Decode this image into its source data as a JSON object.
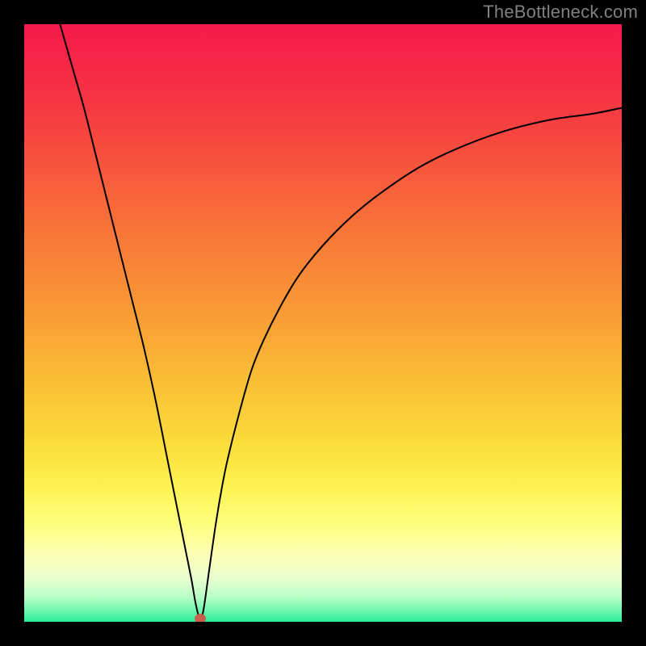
{
  "watermark": "TheBottleneck.com",
  "colors": {
    "background": "#000000",
    "gradient_stops": [
      {
        "pct": 0,
        "color": "#f51a4b"
      },
      {
        "pct": 10,
        "color": "#f62e44"
      },
      {
        "pct": 22,
        "color": "#f7503d"
      },
      {
        "pct": 35,
        "color": "#f87638"
      },
      {
        "pct": 48,
        "color": "#f99a35"
      },
      {
        "pct": 60,
        "color": "#fabf35"
      },
      {
        "pct": 72,
        "color": "#fbe23c"
      },
      {
        "pct": 78,
        "color": "#fdf455"
      },
      {
        "pct": 84,
        "color": "#feff82"
      },
      {
        "pct": 89,
        "color": "#fcffb8"
      },
      {
        "pct": 93,
        "color": "#e6ffcf"
      },
      {
        "pct": 96,
        "color": "#b4ffc6"
      },
      {
        "pct": 98,
        "color": "#72f8af"
      },
      {
        "pct": 100,
        "color": "#2aee98"
      }
    ],
    "curve_stroke": "#000000",
    "dot": "#c86050"
  },
  "chart_data": {
    "type": "line",
    "title": "",
    "xlabel": "",
    "ylabel": "",
    "xlim": [
      0,
      100
    ],
    "ylim": [
      0,
      100
    ],
    "note": "No numeric axis labels are rendered; x and y are normalized 0–100. Higher y = toward top (red). Minimum at x≈29, y≈0.",
    "series": [
      {
        "name": "curve",
        "x": [
          6,
          8,
          10,
          12,
          14,
          16,
          18,
          20,
          22,
          24,
          25,
          26,
          27,
          28,
          28.7,
          29.4,
          30,
          31,
          32,
          33,
          34,
          36,
          38,
          40,
          43,
          46,
          50,
          55,
          60,
          66,
          72,
          80,
          88,
          95,
          100
        ],
        "y": [
          100,
          93,
          86,
          78,
          70,
          62,
          54,
          46,
          37,
          27,
          22,
          17,
          12,
          7,
          3,
          0.5,
          2,
          9,
          16,
          22,
          27,
          35,
          42,
          47,
          53,
          58,
          63,
          68,
          72,
          76,
          79,
          82,
          84,
          85,
          86
        ]
      }
    ],
    "min_point": {
      "x": 29.4,
      "y": 0.5
    }
  }
}
